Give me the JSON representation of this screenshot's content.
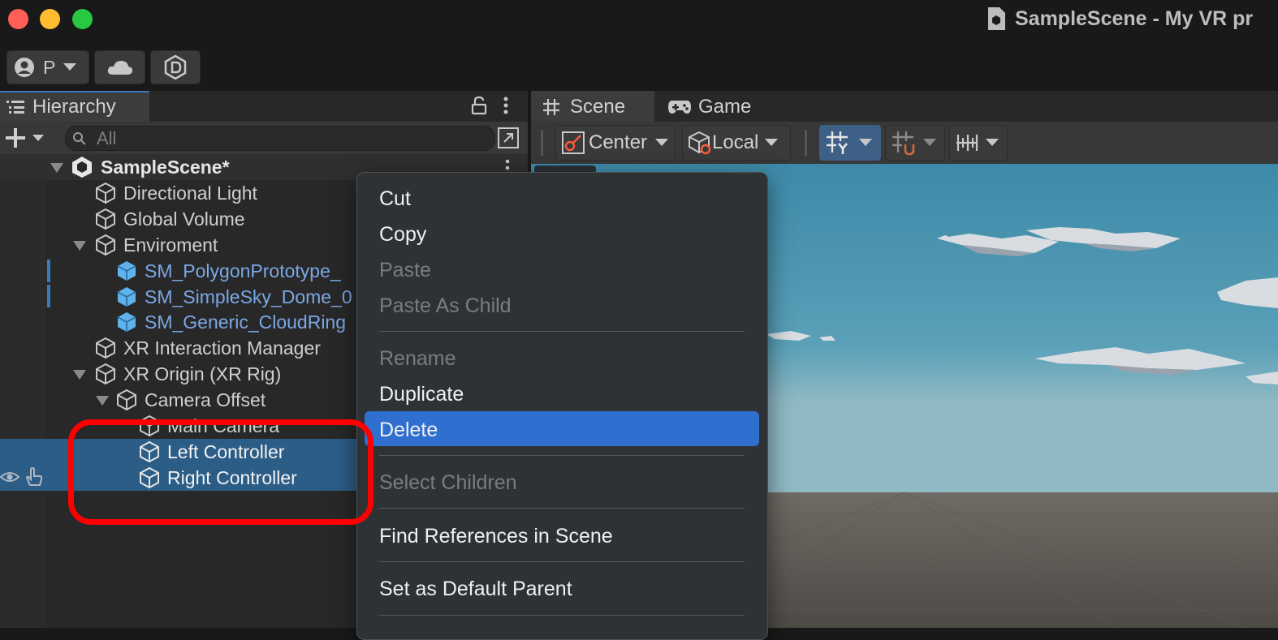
{
  "window": {
    "title": "SampleScene - My VR pr"
  },
  "toolbar": {
    "account_label": "P"
  },
  "hierarchy": {
    "tab_label": "Hierarchy",
    "search_placeholder": "All",
    "scene_name": "SampleScene*",
    "items": [
      {
        "label": "Directional Light"
      },
      {
        "label": "Global Volume"
      },
      {
        "label": "Enviroment"
      },
      {
        "label": "SM_PolygonPrototype_"
      },
      {
        "label": "SM_SimpleSky_Dome_0"
      },
      {
        "label": "SM_Generic_CloudRing"
      },
      {
        "label": "XR Interaction Manager"
      },
      {
        "label": "XR Origin (XR Rig)"
      },
      {
        "label": "Camera Offset"
      },
      {
        "label": "Main Camera"
      },
      {
        "label": "Left Controller"
      },
      {
        "label": "Right Controller"
      }
    ]
  },
  "scene_view": {
    "tabs": [
      {
        "label": "Scene"
      },
      {
        "label": "Game"
      }
    ],
    "pivot_mode": "Center",
    "pivot_rotation": "Local"
  },
  "context_menu": {
    "items": [
      {
        "label": "Cut",
        "enabled": true
      },
      {
        "label": "Copy",
        "enabled": true
      },
      {
        "label": "Paste",
        "enabled": false
      },
      {
        "label": "Paste As Child",
        "enabled": false
      },
      {
        "label": "Rename",
        "enabled": false
      },
      {
        "label": "Duplicate",
        "enabled": true
      },
      {
        "label": "Delete",
        "enabled": true,
        "highlighted": true
      },
      {
        "label": "Select Children",
        "enabled": false
      },
      {
        "label": "Find References in Scene",
        "enabled": true
      },
      {
        "label": "Set as Default Parent",
        "enabled": true
      }
    ]
  },
  "colors": {
    "selection": "#2c5d87",
    "menu_highlight": "#2f6fd0",
    "annotation": "#ff0000",
    "prefab_text": "#7ba7e6"
  }
}
